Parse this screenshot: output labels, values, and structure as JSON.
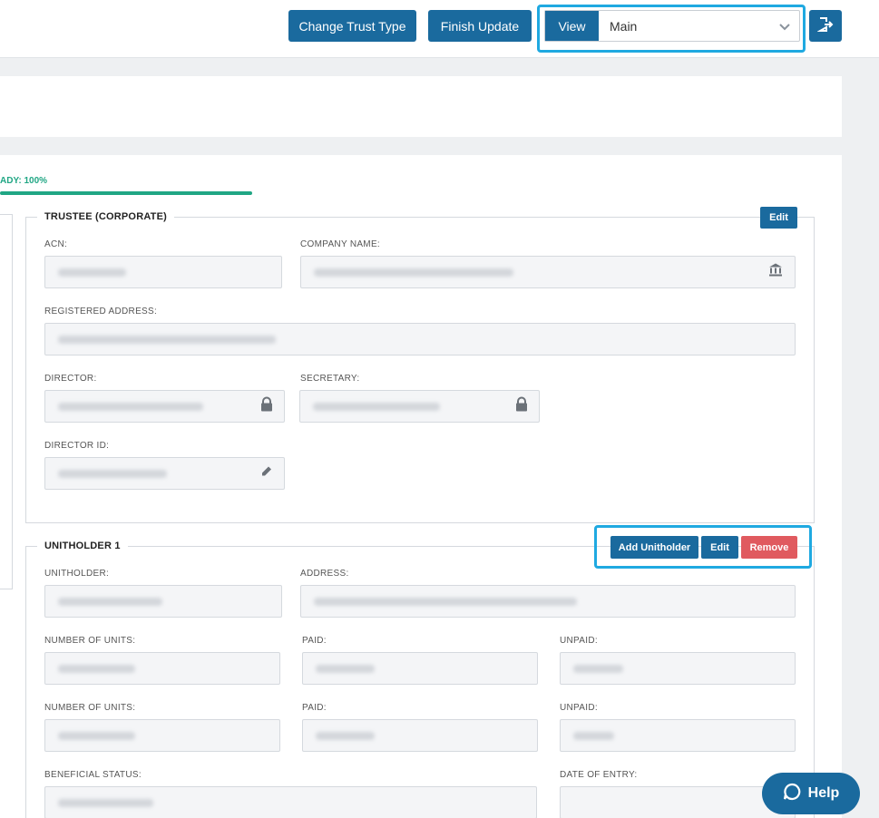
{
  "header": {
    "change_trust_type": "Change Trust Type",
    "finish_update": "Finish Update",
    "view_label": "View",
    "view_value": "Main"
  },
  "progress": {
    "label": "ADY: 100%",
    "percent": 100,
    "color": "#20a684"
  },
  "trustee": {
    "title": "TRUSTEE (CORPORATE)",
    "edit": "Edit",
    "acn_label": "ACN:",
    "company_name_label": "COMPANY NAME:",
    "registered_address_label": "REGISTERED ADDRESS:",
    "director_label": "DIRECTOR:",
    "secretary_label": "SECRETARY:",
    "director_id_label": "DIRECTOR ID:"
  },
  "unitholder": {
    "title": "UNITHOLDER 1",
    "add": "Add Unitholder",
    "edit": "Edit",
    "remove": "Remove",
    "unitholder_label": "UNITHOLDER:",
    "address_label": "ADDRESS:",
    "units_label_1": "NUMBER OF UNITS:",
    "paid_label_1": "PAID:",
    "unpaid_label_1": "UNPAID:",
    "units_label_2": "NUMBER OF UNITS:",
    "paid_label_2": "PAID:",
    "unpaid_label_2": "UNPAID:",
    "beneficial_status_label": "BENEFICIAL STATUS:",
    "date_of_entry_label": "DATE OF ENTRY:"
  },
  "help": {
    "label": "Help"
  },
  "colors": {
    "primary": "#1a6a9e",
    "remove": "#e05a5f",
    "highlight": "#1fa9e1",
    "progress": "#20a684"
  }
}
